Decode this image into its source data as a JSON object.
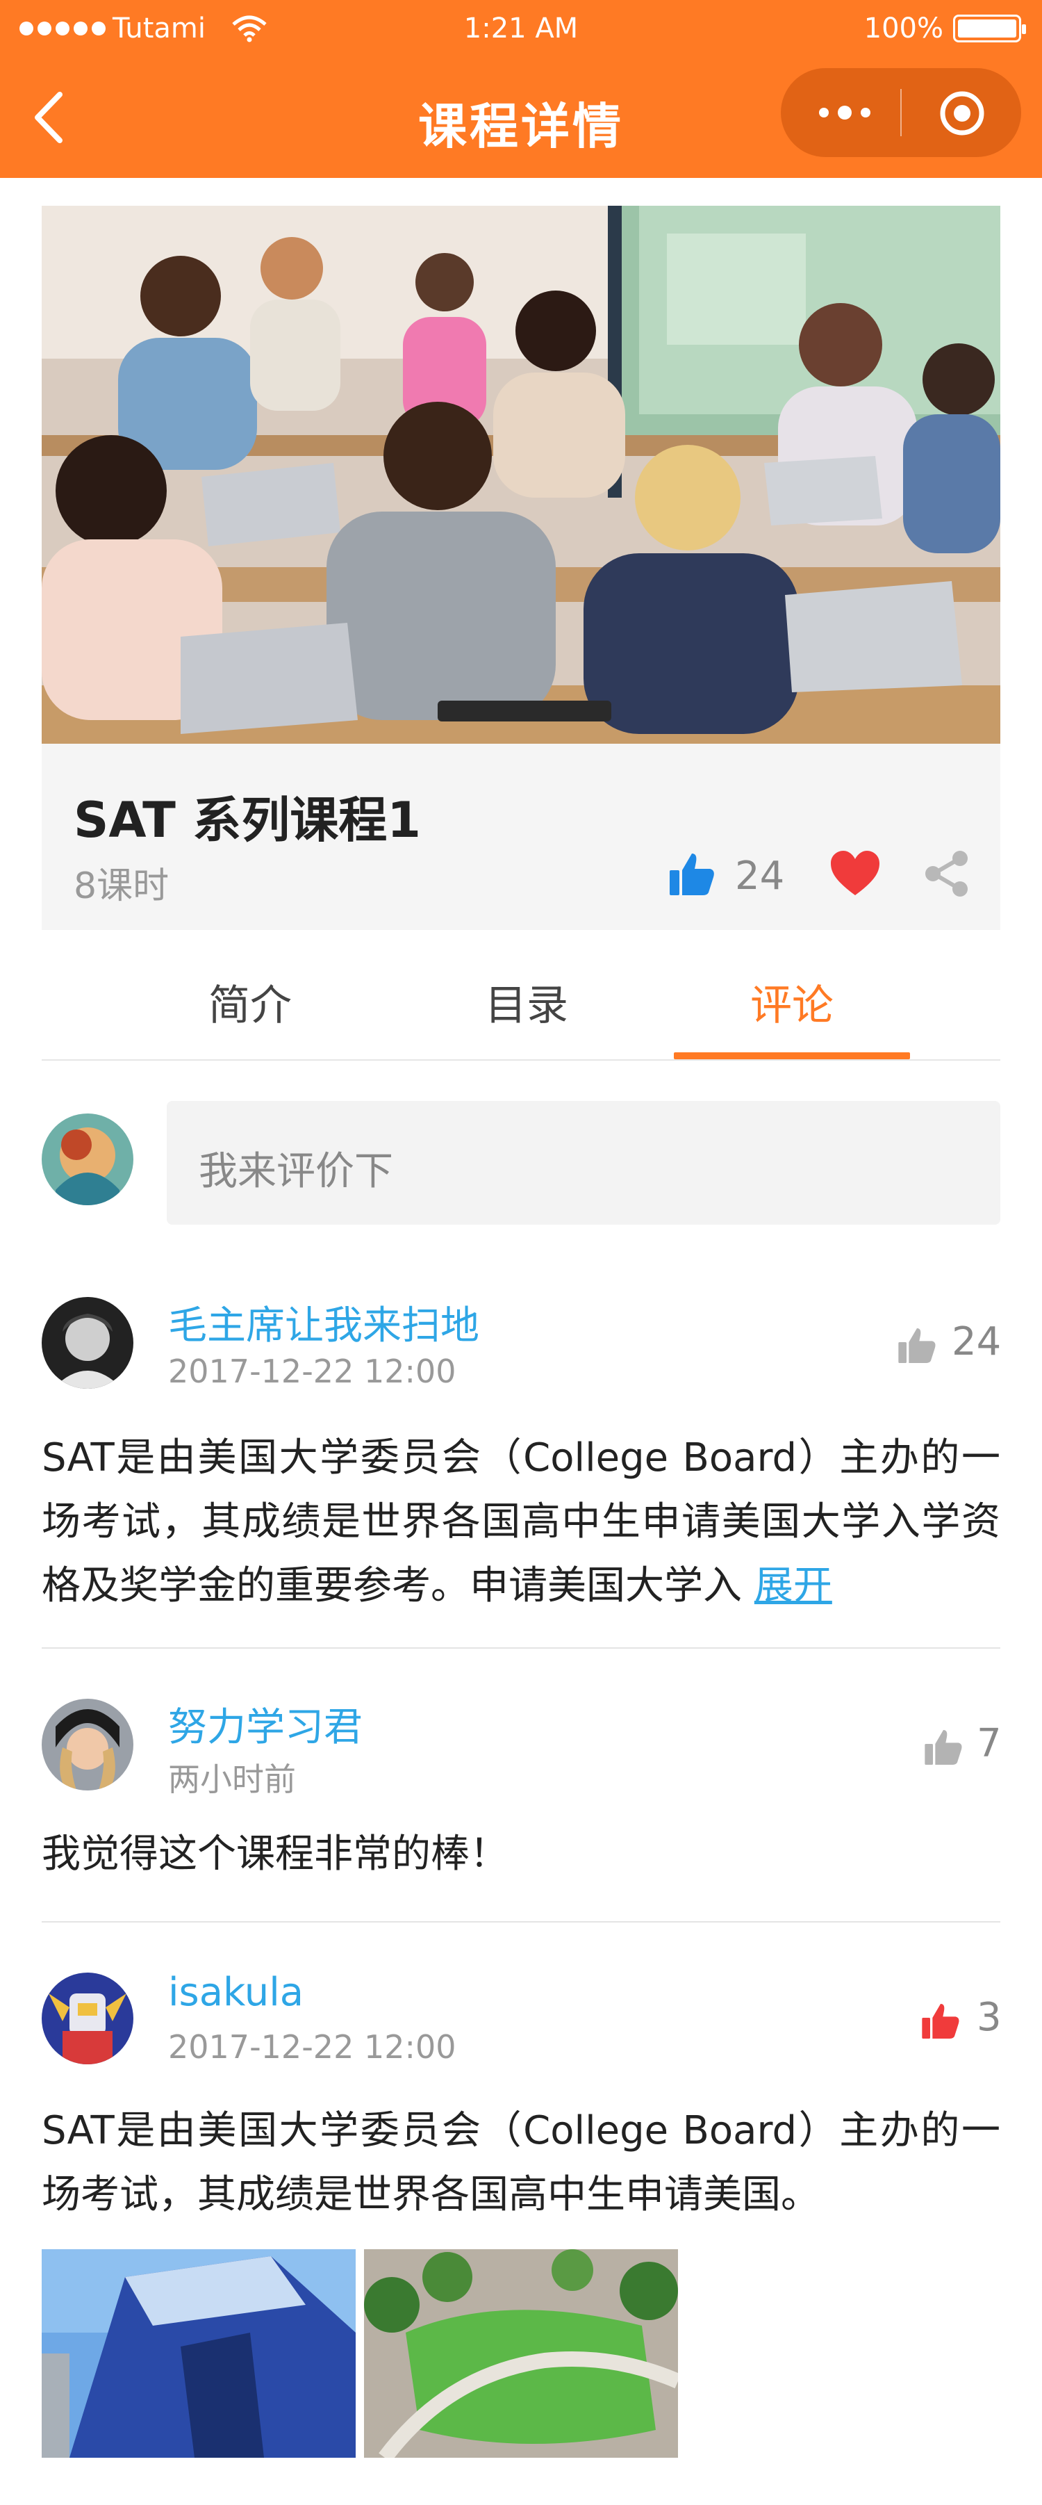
{
  "status_bar": {
    "carrier": "Tutami",
    "time": "1:21 AM",
    "battery": "100%"
  },
  "nav": {
    "title": "课程详情",
    "icons": [
      "back-chevron-icon",
      "more-dots-icon",
      "target-icon"
    ]
  },
  "course": {
    "title": "SAT  系列课程1",
    "lessons": "8课时",
    "like_count": "24"
  },
  "tabs": [
    {
      "label": "简介",
      "active": false
    },
    {
      "label": "目录",
      "active": false
    },
    {
      "label": "评论",
      "active": true
    }
  ],
  "comment_input": {
    "placeholder": "我来评价下"
  },
  "comments": [
    {
      "user": "毛主席让我来扫地",
      "time": "2017-12-22 12:00",
      "likes": "24",
      "liked": false,
      "text": "SAT是由美国大学委员会（College  Board）主办的一场考试，其成绩是世界各国高中生申请美国大学入学资格及奖学金的重要参考。申请美国大学入",
      "expand_label": "展开"
    },
    {
      "user": "努力学习君",
      "time": "两小时前",
      "likes": "7",
      "liked": false,
      "text": "我觉得这个课程非常的棒！"
    },
    {
      "user": "isakula",
      "time": "2017-12-22 12:00",
      "likes": "3",
      "liked": true,
      "text": "SAT是由美国大学委员会（College  Board）主办的一场考试，其成绩是世界各国高中生申请美国。"
    }
  ],
  "colors": {
    "brand": "#ff7a24",
    "link": "#2ea6e6",
    "like_blue": "#1e88e5",
    "heart_red": "#f03b3b"
  }
}
